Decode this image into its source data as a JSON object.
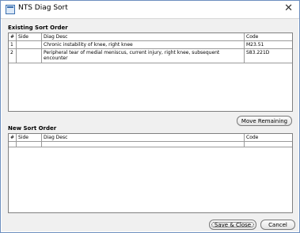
{
  "window": {
    "title": "NTS Diag Sort",
    "close_glyph": "✕"
  },
  "existing": {
    "label": "Existing Sort Order",
    "columns": [
      "#",
      "Side",
      "Diag Desc",
      "Code"
    ],
    "rows": [
      {
        "num": "1",
        "side": "",
        "desc": "Chronic instability of knee, right knee",
        "code": "M23.51"
      },
      {
        "num": "2",
        "side": "",
        "desc": "Peripheral tear of medial meniscus, current injury, right knee, subsequent encounter",
        "code": "S83.221D"
      }
    ]
  },
  "buttons": {
    "move_remaining": "Move Remaining",
    "save_close": "Save & Close",
    "cancel": "Cancel"
  },
  "new": {
    "label": "New Sort Order",
    "columns": [
      "#",
      "Side",
      "Diag Desc",
      "Code"
    ]
  }
}
